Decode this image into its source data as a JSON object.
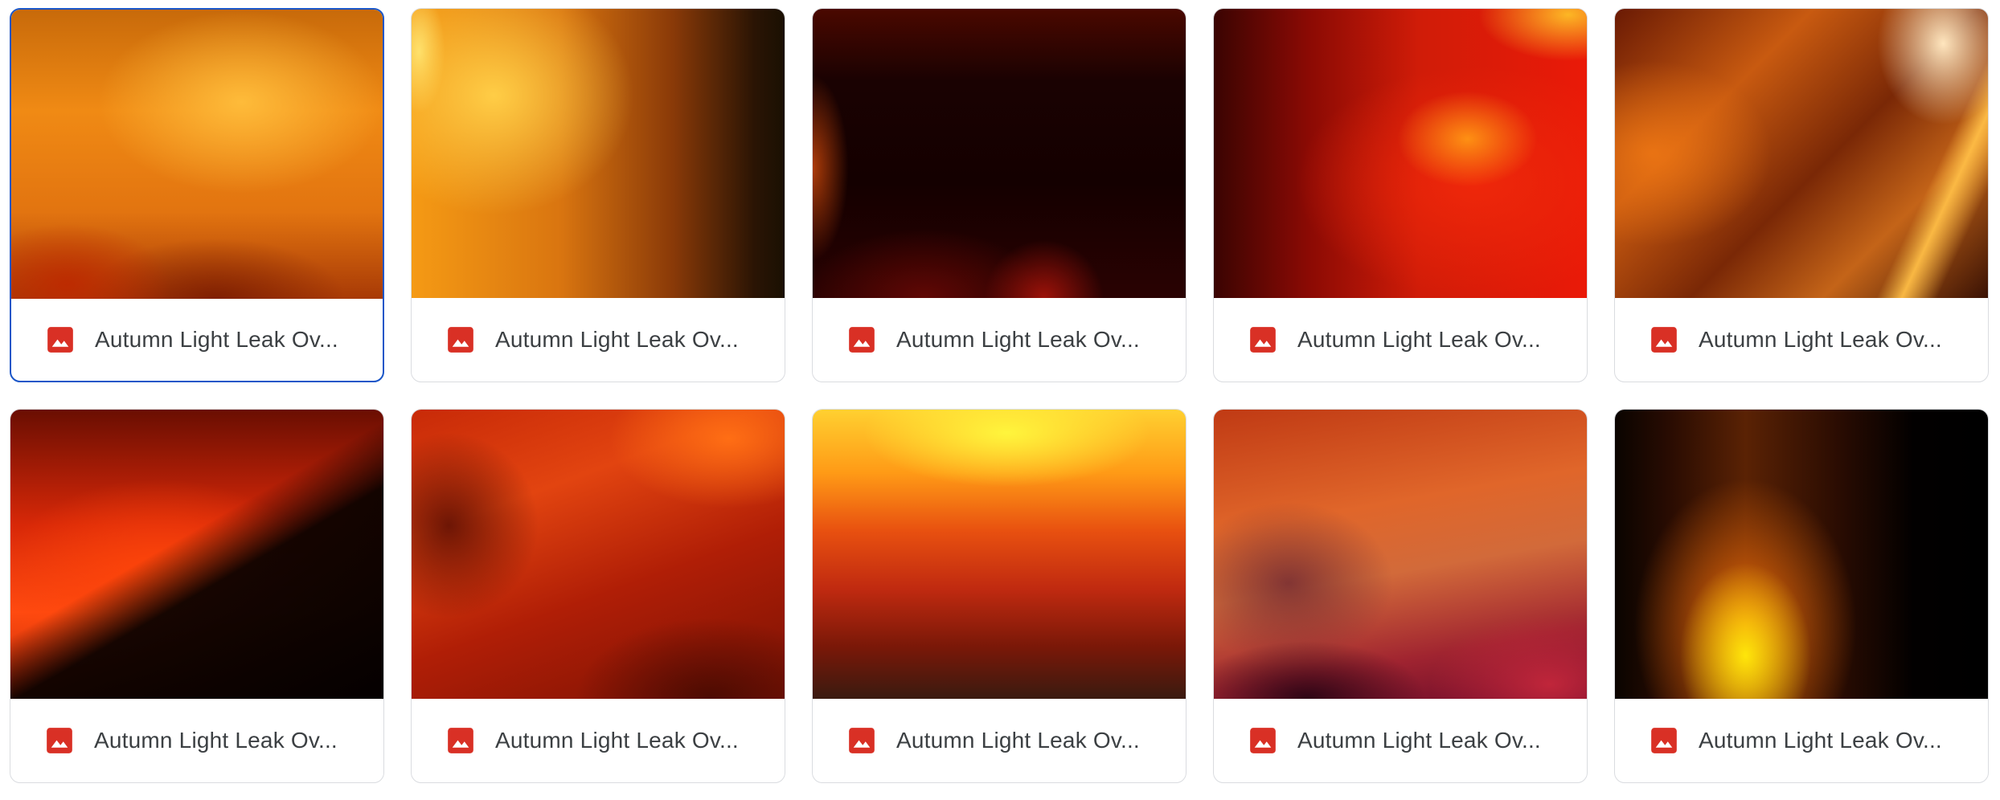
{
  "files": [
    {
      "name": "Autumn Light Leak Ov...",
      "icon": "image-file-icon",
      "selected": true
    },
    {
      "name": "Autumn Light Leak Ov...",
      "icon": "image-file-icon",
      "selected": false
    },
    {
      "name": "Autumn Light Leak Ov...",
      "icon": "image-file-icon",
      "selected": false
    },
    {
      "name": "Autumn Light Leak Ov...",
      "icon": "image-file-icon",
      "selected": false
    },
    {
      "name": "Autumn Light Leak Ov...",
      "icon": "image-file-icon",
      "selected": false
    },
    {
      "name": "Autumn Light Leak Ov...",
      "icon": "image-file-icon",
      "selected": false
    },
    {
      "name": "Autumn Light Leak Ov...",
      "icon": "image-file-icon",
      "selected": false
    },
    {
      "name": "Autumn Light Leak Ov...",
      "icon": "image-file-icon",
      "selected": false
    },
    {
      "name": "Autumn Light Leak Ov...",
      "icon": "image-file-icon",
      "selected": false
    },
    {
      "name": "Autumn Light Leak Ov...",
      "icon": "image-file-icon",
      "selected": false
    }
  ],
  "colors": {
    "icon_red": "#d93025",
    "selection_border": "#1a56c8",
    "card_border": "#dadce0",
    "text": "#3c4043"
  }
}
